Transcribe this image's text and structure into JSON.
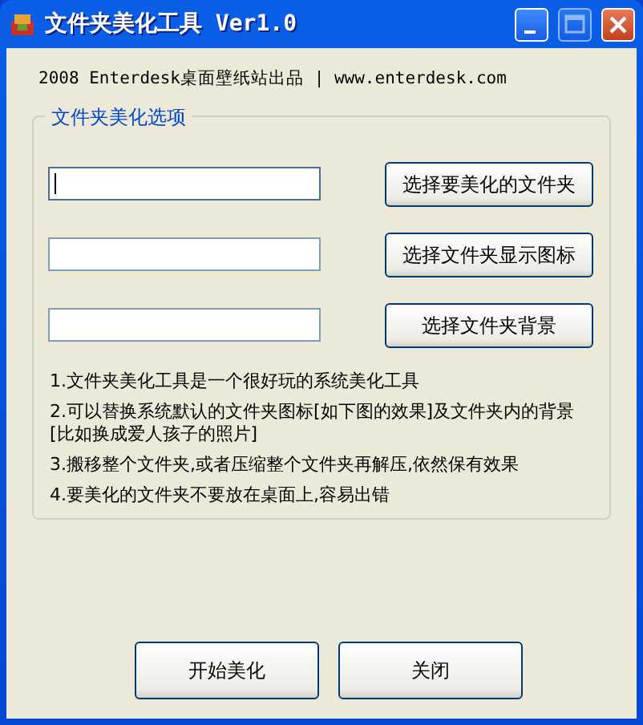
{
  "window": {
    "title": "文件夹美化工具 Ver1.0"
  },
  "header": "2008 Enterdesk桌面壁纸站出品 | www.enterdesk.com",
  "group": {
    "title": "文件夹美化选项",
    "rows": [
      {
        "field": {
          "focused": true
        },
        "button": "选择要美化的文件夹"
      },
      {
        "field": {
          "focused": false
        },
        "button": "选择文件夹显示图标"
      },
      {
        "field": {
          "focused": false
        },
        "button": "选择文件夹背景"
      }
    ],
    "notes": [
      "1.文件夹美化工具是一个很好玩的系统美化工具",
      "2.可以替换系统默认的文件夹图标[如下图的效果]及文件夹内的背景[比如换成爱人孩子的照片]",
      "3.搬移整个文件夹,或者压缩整个文件夹再解压,依然保有效果",
      "4.要美化的文件夹不要放在桌面上,容易出错"
    ]
  },
  "buttons": [
    "开始美化",
    "关闭"
  ]
}
